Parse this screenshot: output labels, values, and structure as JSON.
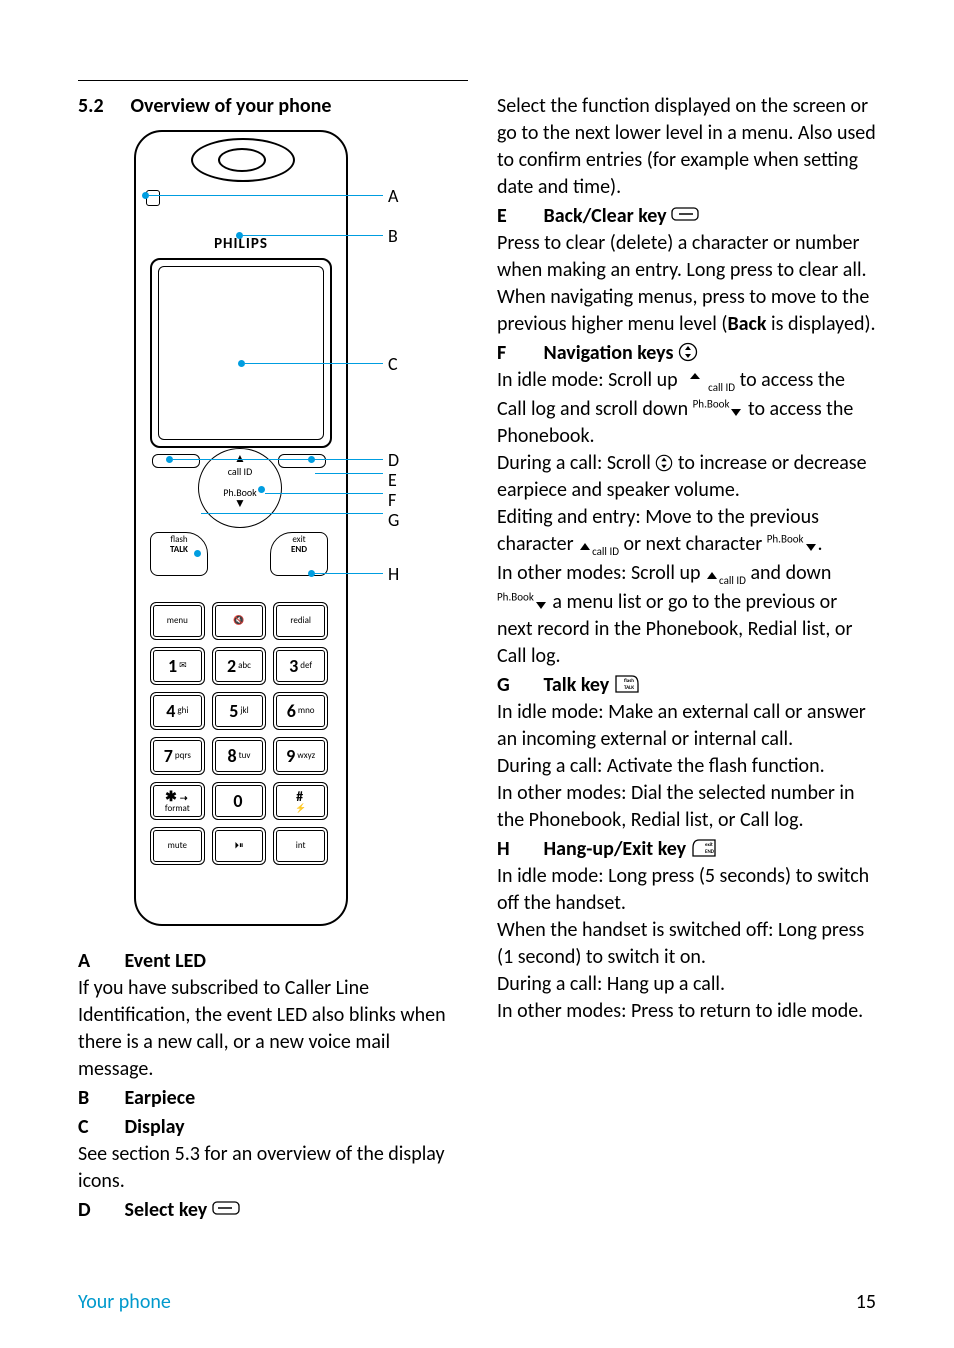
{
  "section": {
    "number": "5.2",
    "title": "Overview of your phone"
  },
  "diagram": {
    "brand": "PHILIPS",
    "nav": {
      "up": "▲",
      "up_label": "call ID",
      "down_label": "Ph.Book",
      "down": "▼"
    },
    "talk": {
      "top": "flash",
      "bottom": "TALK"
    },
    "end": {
      "top": "exit",
      "bottom": "END"
    },
    "keys": {
      "menu": "menu",
      "mute_icon": "🔇",
      "redial": "redial",
      "k1": "1",
      "k1s": "✉",
      "k2": "2",
      "k2s": "abc",
      "k3": "3",
      "k3s": "def",
      "k4": "4",
      "k4s": "ghi",
      "k5": "5",
      "k5s": "jkl",
      "k6": "6",
      "k6s": "mno",
      "k7": "7",
      "k7s": "pqrs",
      "k8": "8",
      "k8s": "tuv",
      "k9": "9",
      "k9s": "wxyz",
      "star": "✱",
      "star_s": "⇢",
      "format": "format",
      "k0": "0",
      "hash": "#",
      "hash_s": "⚡",
      "mute": "mute",
      "tape": "⏵⏸",
      "int": "int"
    },
    "callouts": {
      "A": "A",
      "B": "B",
      "C": "C",
      "D": "D",
      "E": "E",
      "F": "F",
      "G": "G",
      "H": "H"
    }
  },
  "left": {
    "A": {
      "letter": "A",
      "title": "Event LED",
      "body": "If you have subscribed to Caller Line Identification, the event LED also blinks when there is a new call, or a new voice mail message."
    },
    "B": {
      "letter": "B",
      "title": "Earpiece"
    },
    "C": {
      "letter": "C",
      "title": "Display",
      "body": "See section 5.3 for an overview of the display icons."
    },
    "D": {
      "letter": "D",
      "title": "Select key "
    }
  },
  "right": {
    "D_body": "Select the function displayed on the screen or go to the next lower level in a menu. Also used to confirm entries (for example when setting date and time).",
    "E": {
      "letter": "E",
      "title": "Back/Clear key ",
      "body1": "Press to clear (delete) a character or number when making an entry. Long press to clear all.",
      "body2_a": "When navigating menus, press to move to the previous higher menu level (",
      "body2_bold": "Back",
      "body2_b": " is displayed)."
    },
    "F": {
      "letter": "F",
      "title": "Navigation keys ",
      "l1a": "In idle mode: Scroll up ",
      "l1b": " to access the Call log and scroll down ",
      "l1c": " to access the Phonebook.",
      "l2a": "During a call: Scroll ",
      "l2b": " to increase or decrease earpiece and speaker volume.",
      "l3a": "Editing and entry: Move to the previous character ",
      "l3b": " or next character ",
      "l3c": ".",
      "l4a": "In other modes: Scroll up ",
      "l4b": " and down ",
      "l4c": " a menu list or go to the previous or next record in the Phonebook, Redial list, or Call log."
    },
    "G": {
      "letter": "G",
      "title": "Talk key ",
      "l1": "In idle mode: Make an external call or answer an incoming external or internal call.",
      "l2": "During a call: Activate the flash function.",
      "l3": "In other modes: Dial the selected number in the Phonebook, Redial list, or Call log."
    },
    "H": {
      "letter": "H",
      "title": "Hang-up/Exit key ",
      "l1": "In idle mode: Long press (5 seconds) to switch off the handset.",
      "l2": "When the handset is switched off: Long press (1 second) to switch it on.",
      "l3": "During a call: Hang up a call.",
      "l4": "In other modes: Press to return to idle mode."
    }
  },
  "inline_labels": {
    "callid_up": "call ID",
    "phbook_down": "Ph.Book"
  },
  "footer": {
    "left": "Your phone",
    "right": "15"
  }
}
